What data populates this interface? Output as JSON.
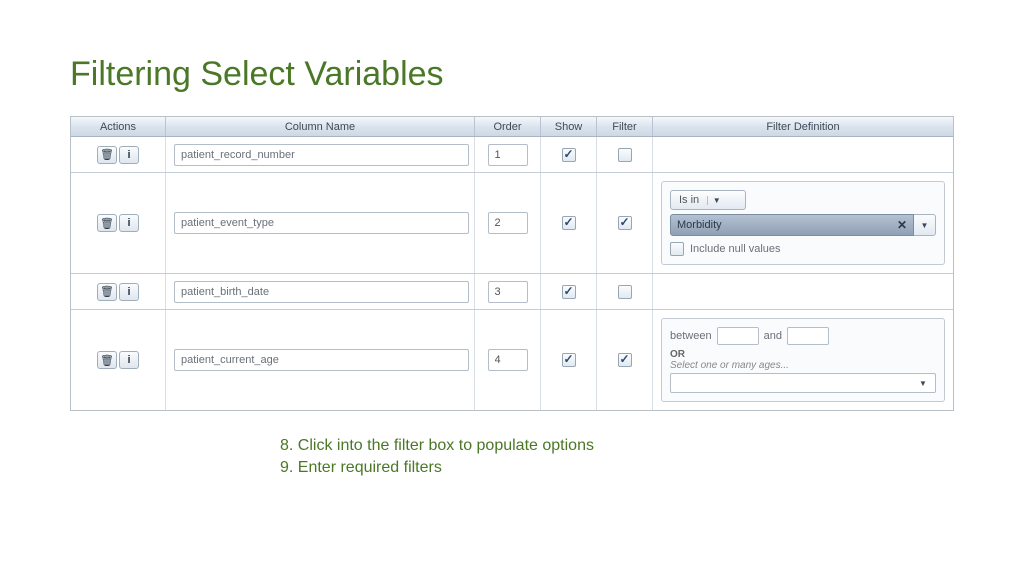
{
  "title": "Filtering Select Variables",
  "headers": {
    "actions": "Actions",
    "column_name": "Column Name",
    "order": "Order",
    "show": "Show",
    "filter": "Filter",
    "filter_def": "Filter Definition"
  },
  "rows": [
    {
      "name": "patient_record_number",
      "order": "1",
      "show": true,
      "filter": false,
      "filter_def": null
    },
    {
      "name": "patient_event_type",
      "order": "2",
      "show": true,
      "filter": true,
      "filter_def": "isin"
    },
    {
      "name": "patient_birth_date",
      "order": "3",
      "show": true,
      "filter": false,
      "filter_def": null
    },
    {
      "name": "patient_current_age",
      "order": "4",
      "show": true,
      "filter": true,
      "filter_def": "between"
    }
  ],
  "filter_isin": {
    "operator": "Is in",
    "tag_value": "Morbidity",
    "include_null_label": "Include null values"
  },
  "filter_between": {
    "between_label": "between",
    "and_label": "and",
    "or_label": "OR",
    "select_ages_label": "Select one or many ages..."
  },
  "instructions": {
    "line1": "8. Click into the filter box to populate options",
    "line2": "9. Enter required filters"
  }
}
